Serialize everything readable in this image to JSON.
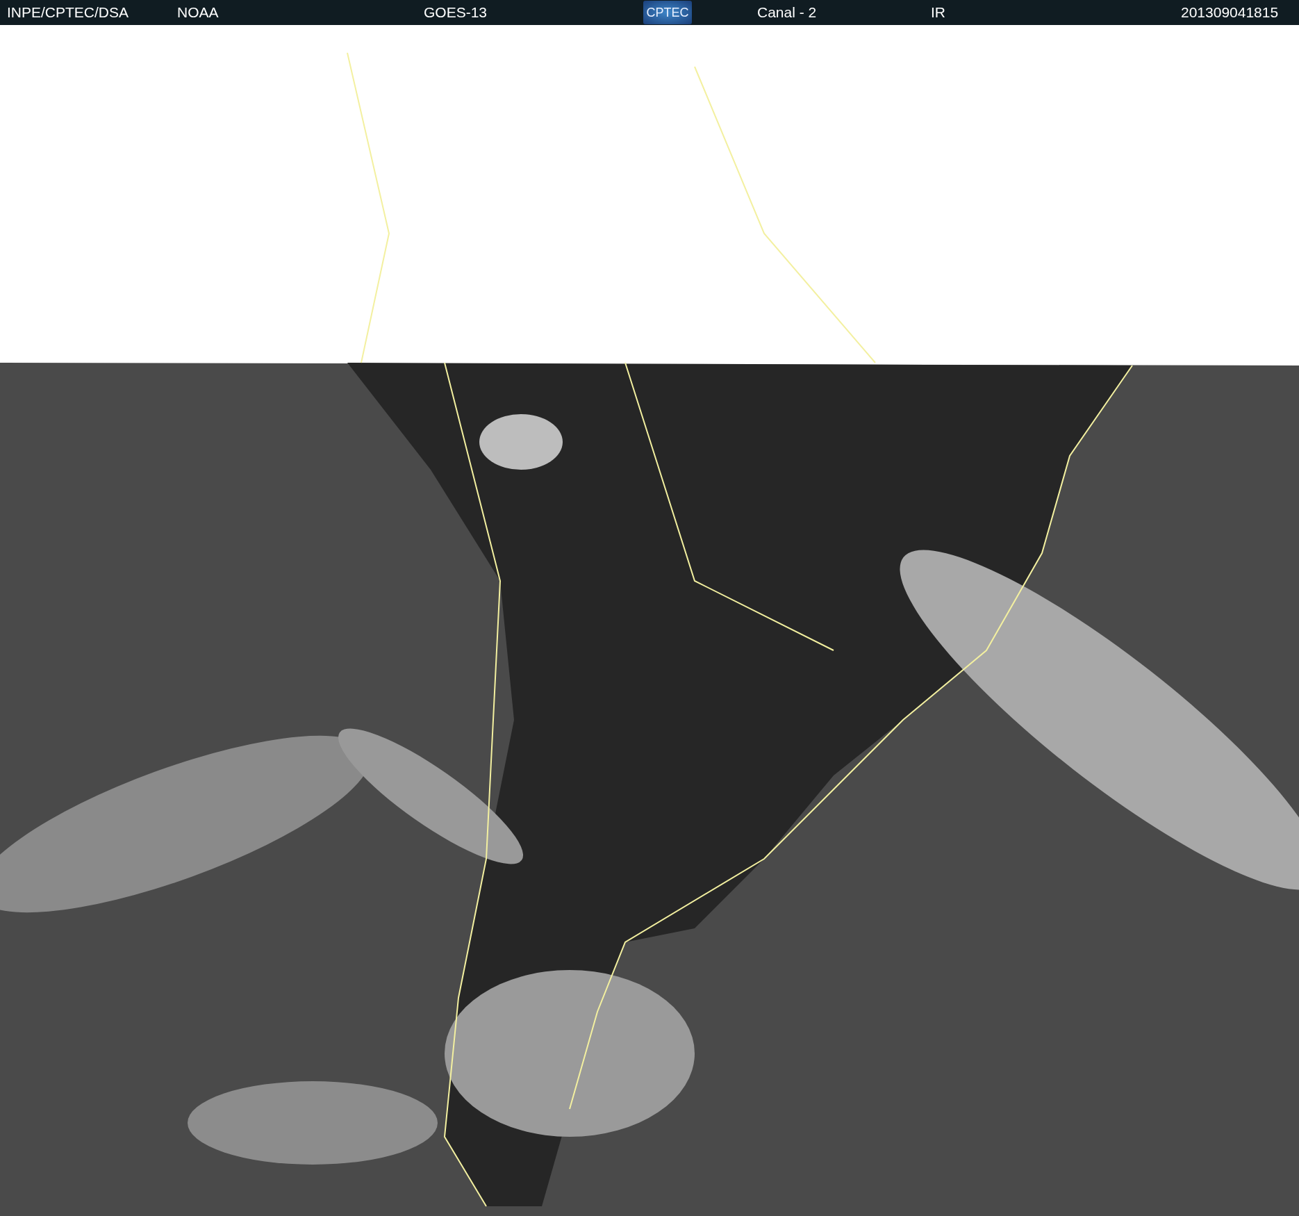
{
  "header": {
    "source": "INPE/CPTEC/DSA",
    "agency": "NOAA",
    "satellite": "GOES-13",
    "logo_text": "CPTEC",
    "channel": "Canal - 2",
    "band": "IR",
    "timestamp": "201309041815"
  }
}
